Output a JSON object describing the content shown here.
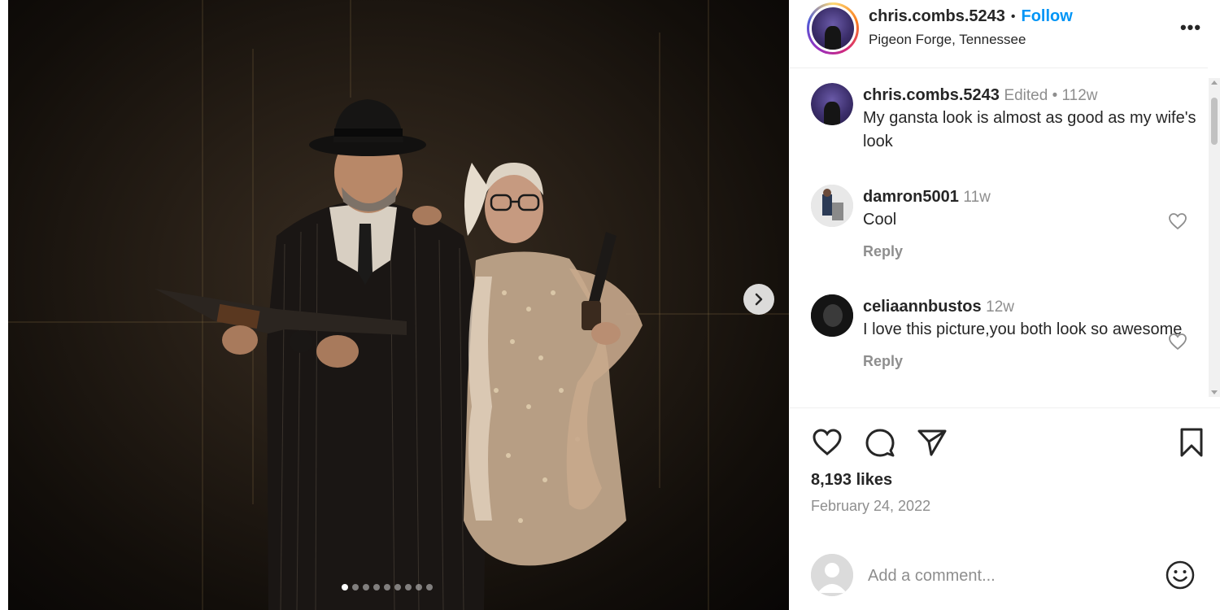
{
  "post": {
    "username": "chris.combs.5243",
    "separator": "•",
    "follow_label": "Follow",
    "location": "Pigeon Forge, Tennessee",
    "more_label": "•••",
    "carousel": {
      "total": 9,
      "active_index": 0
    }
  },
  "caption": {
    "username": "chris.combs.5243",
    "meta": "Edited •  112w",
    "text": "My gansta look is almost as good as my wife's look"
  },
  "comments": [
    {
      "username": "damron5001",
      "meta": "11w",
      "text": "Cool",
      "reply_label": "Reply"
    },
    {
      "username": "celiaannbustos",
      "meta": "12w",
      "text": "I love this picture,you both look so awesome",
      "reply_label": "Reply"
    }
  ],
  "stats": {
    "likes": "8,193 likes",
    "date": "February 24, 2022"
  },
  "add_comment": {
    "placeholder": "Add a comment..."
  },
  "icons": {
    "like": "heart-icon",
    "comment": "comment-icon",
    "share": "send-icon",
    "save": "bookmark-icon",
    "emoji": "smiley-icon",
    "next": "chevron-right-icon"
  },
  "colors": {
    "link": "#0095f6",
    "muted": "#8e8e8e",
    "text": "#262626"
  }
}
